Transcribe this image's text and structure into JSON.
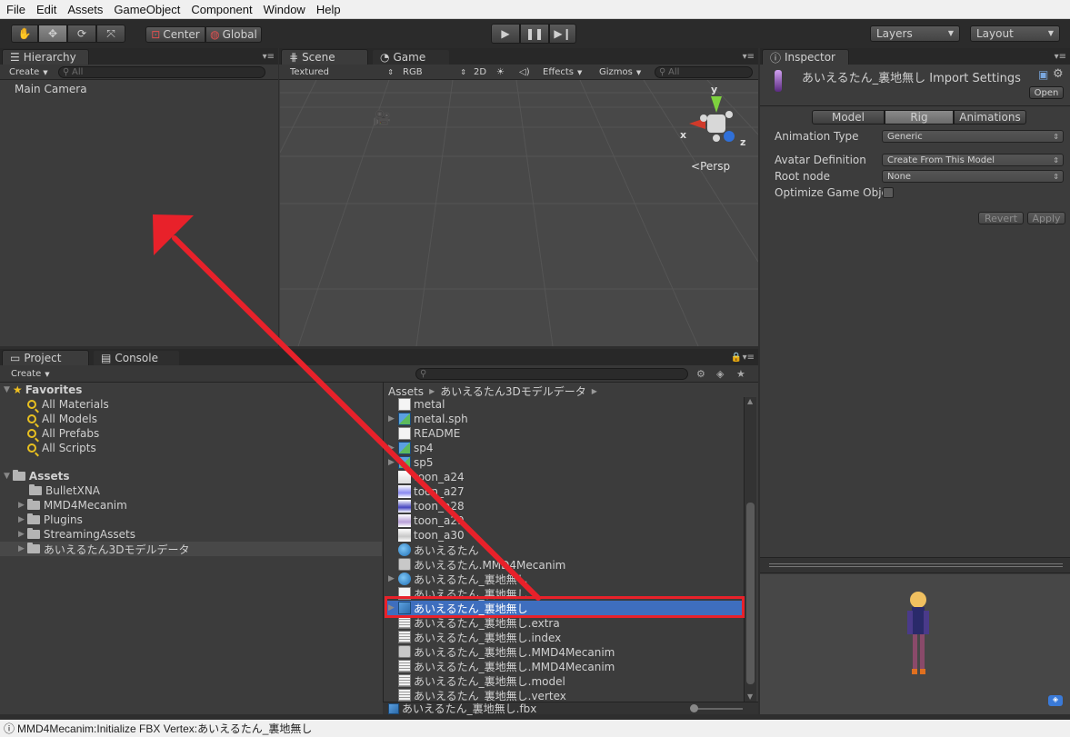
{
  "menu": [
    "File",
    "Edit",
    "Assets",
    "GameObject",
    "Component",
    "Window",
    "Help"
  ],
  "toolbar": {
    "pivot": "Center",
    "space": "Global",
    "layers": "Layers",
    "layout": "Layout"
  },
  "hierarchy": {
    "tab": "Hierarchy",
    "create": "Create",
    "search_placeholder": "All",
    "items": [
      "Main Camera"
    ]
  },
  "scene": {
    "tab_scene": "Scene",
    "tab_game": "Game",
    "shading": "Textured",
    "render": "RGB",
    "mode_2d": "2D",
    "effects": "Effects",
    "gizmos": "Gizmos",
    "search_placeholder": "All",
    "persp": "Persp",
    "axis_x": "x",
    "axis_y": "y",
    "axis_z": "z"
  },
  "inspector": {
    "tab": "Inspector",
    "title": "あいえるたん_裏地無し Import Settings",
    "open": "Open",
    "tabs": [
      "Model",
      "Rig",
      "Animations"
    ],
    "active_tab": "Rig",
    "rows": [
      {
        "label": "Animation Type",
        "value": "Generic"
      },
      {
        "label": "Avatar Definition",
        "value": "Create From This Model"
      },
      {
        "label": "Root node",
        "value": "None"
      },
      {
        "label": "Optimize Game Obje",
        "value": ""
      }
    ],
    "revert": "Revert",
    "apply": "Apply"
  },
  "project": {
    "tab_project": "Project",
    "tab_console": "Console",
    "create": "Create",
    "favorites_label": "Favorites",
    "favorites": [
      "All Materials",
      "All Models",
      "All Prefabs",
      "All Scripts"
    ],
    "assets_label": "Assets",
    "folders": [
      "BulletXNA",
      "MMD4Mecanim",
      "Plugins",
      "StreamingAssets",
      "あいえるたん3Dモデルデータ"
    ],
    "breadcrumb": [
      "Assets",
      "あいえるたん3Dモデルデータ"
    ],
    "files": [
      {
        "name": "metal",
        "icon": "doc"
      },
      {
        "name": "metal.sph",
        "icon": "cubeg"
      },
      {
        "name": "README",
        "icon": "doc"
      },
      {
        "name": "sp4",
        "icon": "cubeg"
      },
      {
        "name": "sp5",
        "icon": "cubeg"
      },
      {
        "name": "toon_a24",
        "icon": "t24"
      },
      {
        "name": "toon_a27",
        "icon": "t27"
      },
      {
        "name": "toon_a28",
        "icon": "t28"
      },
      {
        "name": "toon_a29",
        "icon": "t29"
      },
      {
        "name": "toon_a30",
        "icon": "t30"
      },
      {
        "name": "あいえるたん",
        "icon": "globe"
      },
      {
        "name": "あいえるたん.MMD4Mecanim",
        "icon": "script"
      },
      {
        "name": "あいえるたん_裏地無し",
        "icon": "globe"
      },
      {
        "name": "あいえるたん_裏地無し",
        "icon": "doc"
      },
      {
        "name": "あいえるたん_裏地無し",
        "icon": "cube",
        "selected": true
      },
      {
        "name": "あいえるたん_裏地無し.extra",
        "icon": "txt"
      },
      {
        "name": "あいえるたん_裏地無し.index",
        "icon": "txt"
      },
      {
        "name": "あいえるたん_裏地無し.MMD4Mecanim",
        "icon": "script"
      },
      {
        "name": "あいえるたん_裏地無し.MMD4Mecanim",
        "icon": "txt"
      },
      {
        "name": "あいえるたん_裏地無し.model",
        "icon": "txt"
      },
      {
        "name": "あいえるたん_裏地無し.vertex",
        "icon": "txt"
      }
    ],
    "footer_file": "あいえるたん_裏地無し.fbx"
  },
  "status_bar": "MMD4Mecanim:Initialize FBX Vertex:あいえるたん_裏地無し",
  "colors": {
    "highlight": "#e8212a",
    "selection": "#3e6ebe"
  }
}
